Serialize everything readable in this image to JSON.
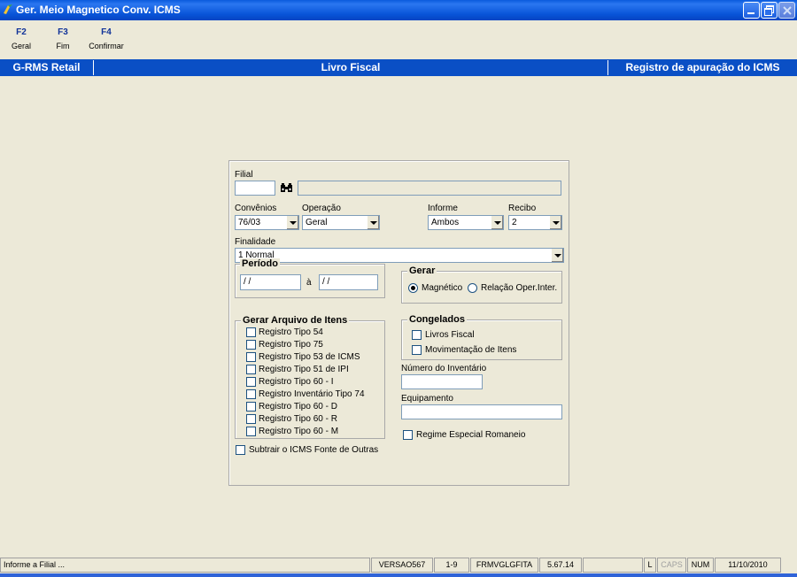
{
  "window": {
    "title": "Ger. Meio Magnetico  Conv. ICMS"
  },
  "toolbar": {
    "keys": [
      {
        "key": "F2",
        "label": "Geral"
      },
      {
        "key": "F3",
        "label": "Fim"
      },
      {
        "key": "F4",
        "label": "Confirmar"
      }
    ]
  },
  "header": {
    "left": "G-RMS Retail",
    "center": "Livro Fiscal",
    "right": "Registro de apuração do ICMS"
  },
  "form": {
    "filial_label": "Filial",
    "filial_value": "",
    "filial_name": "",
    "convenios_label": "Convênios",
    "convenios_value": "76/03",
    "operacao_label": "Operação",
    "operacao_value": "Geral",
    "informe_label": "Informe",
    "informe_value": "Ambos",
    "recibo_label": "Recibo",
    "recibo_value": "2",
    "finalidade_label": "Finalidade",
    "finalidade_value": "1 Normal",
    "periodo": {
      "title": "Período",
      "start": " / /",
      "separator": "à",
      "end": " / /"
    },
    "gerar": {
      "title": "Gerar",
      "option_magnetico": "Magnético",
      "option_relacao": "Relação Oper.Inter.",
      "selected": "Magnético"
    },
    "gerar_itens": {
      "title": "Gerar Arquivo de Itens",
      "items": [
        "Registro Tipo 54",
        "Registro Tipo 75",
        "Registro Tipo 53 de ICMS",
        "Registro Tipo 51 de IPI",
        "Registro Tipo 60 - I",
        "Registro Inventário Tipo 74",
        "Registro Tipo 60 - D",
        "Registro Tipo 60 - R",
        "Registro Tipo 60 - M"
      ]
    },
    "congelados": {
      "title": "Congelados",
      "items": [
        "Livros Fiscal",
        "Movimentação de Itens"
      ]
    },
    "numero_inventario_label": "Número do Inventário",
    "numero_inventario_value": "",
    "equipamento_label": "Equipamento",
    "equipamento_value": "",
    "regime_especial": "Regime Especial Romaneio",
    "subtrair_icms": "Subtrair o ICMS Fonte de Outras"
  },
  "statusbar": {
    "message": "Informe a Filial ...",
    "version": "VERSAO567",
    "range": "1-9",
    "form": "FRMVGLGFITA",
    "build": "5.67.14",
    "empty": "",
    "l": "L",
    "caps": "CAPS",
    "num": "NUM",
    "date": "11/10/2010"
  },
  "colors": {
    "titlebar": "#0A5BDD",
    "header_bar": "#0A4FC5",
    "background": "#ECE9D8"
  }
}
